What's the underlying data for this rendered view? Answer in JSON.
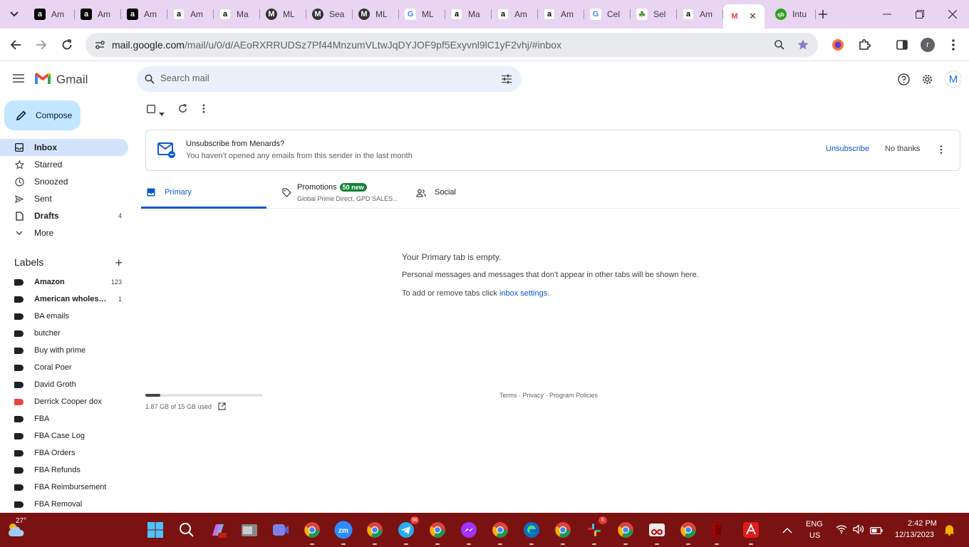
{
  "browser": {
    "tabs": [
      {
        "title": "Am",
        "favicon": "amazon-icon",
        "color": "#000000"
      },
      {
        "title": "Am",
        "favicon": "amazon-icon",
        "color": "#000000"
      },
      {
        "title": "Am",
        "favicon": "amazon-icon",
        "color": "#000000"
      },
      {
        "title": "Am",
        "favicon": "amazon-smile-icon",
        "color": "#ffffff"
      },
      {
        "title": "Ma",
        "favicon": "amazon-smile-icon",
        "color": "#ffffff"
      },
      {
        "title": "ML",
        "favicon": "mag-icon",
        "color": "#333333"
      },
      {
        "title": "Sea",
        "favicon": "mag-icon",
        "color": "#333333"
      },
      {
        "title": "ML",
        "favicon": "mag-icon",
        "color": "#333333"
      },
      {
        "title": "ML",
        "favicon": "google-icon",
        "color": "#ffffff"
      },
      {
        "title": "Ma",
        "favicon": "amazon-smile-icon",
        "color": "#ffffff"
      },
      {
        "title": "Am",
        "favicon": "amazon-smile-icon",
        "color": "#ffffff"
      },
      {
        "title": "Am",
        "favicon": "amazon-smile-icon",
        "color": "#ffffff"
      },
      {
        "title": "Cel",
        "favicon": "google-icon",
        "color": "#ffffff"
      },
      {
        "title": "Sel",
        "favicon": "plant-icon",
        "color": "#ffffff"
      },
      {
        "title": "Am",
        "favicon": "amazon-smile-icon",
        "color": "#ffffff"
      },
      {
        "title": "",
        "favicon": "gmail-icon",
        "color": "#ffffff",
        "active": true
      },
      {
        "title": "Intu",
        "favicon": "quickbooks-icon",
        "color": "#2ca01c"
      }
    ],
    "url_host": "mail.google.com",
    "url_path": "/mail/u/0/d/AEoRXRRUDSz7Pf44MnzumVLtwJqDYJOF9pf5Exyvnl9lC1yF2vhj/#inbox",
    "profile_initial": "r"
  },
  "gmail": {
    "logo_text": "Gmail",
    "search_placeholder": "Search mail",
    "avatar_initial": "M",
    "compose_label": "Compose",
    "nav": [
      {
        "label": "Inbox",
        "icon": "inbox-icon",
        "count": "",
        "active": true
      },
      {
        "label": "Starred",
        "icon": "star-icon",
        "count": ""
      },
      {
        "label": "Snoozed",
        "icon": "clock-icon",
        "count": ""
      },
      {
        "label": "Sent",
        "icon": "send-icon",
        "count": ""
      },
      {
        "label": "Drafts",
        "icon": "draft-icon",
        "count": "4",
        "bold": true
      },
      {
        "label": "More",
        "icon": "chevron-down-icon",
        "count": ""
      }
    ],
    "labels_title": "Labels",
    "labels": [
      {
        "name": "Amazon",
        "count": "123",
        "bold": true,
        "color": "#202124"
      },
      {
        "name": "American wholesal...",
        "count": "1",
        "bold": true,
        "color": "#202124"
      },
      {
        "name": "BA emails",
        "count": "",
        "color": "#202124"
      },
      {
        "name": "butcher",
        "count": "",
        "color": "#202124"
      },
      {
        "name": "Buy with prime",
        "count": "",
        "color": "#202124"
      },
      {
        "name": "Coral Poer",
        "count": "",
        "color": "#202124"
      },
      {
        "name": "David Groth",
        "count": "",
        "color": "#202124"
      },
      {
        "name": "Derrick Cooper dox",
        "count": "",
        "color": "#e8453c"
      },
      {
        "name": "FBA",
        "count": "",
        "color": "#202124"
      },
      {
        "name": "FBA Case Log",
        "count": "",
        "color": "#202124"
      },
      {
        "name": "FBA Orders",
        "count": "",
        "color": "#202124"
      },
      {
        "name": "FBA Refunds",
        "count": "",
        "color": "#202124"
      },
      {
        "name": "FBA Reimbursement",
        "count": "",
        "color": "#202124"
      },
      {
        "name": "FBA Removal",
        "count": "",
        "color": "#202124"
      }
    ],
    "banner": {
      "title": "Unsubscribe from Menards?",
      "subtitle": "You haven't opened any emails from this sender in the last month",
      "unsubscribe": "Unsubscribe",
      "no_thanks": "No thanks"
    },
    "tabs": {
      "primary": "Primary",
      "promotions": "Promotions",
      "promotions_badge": "50 new",
      "promotions_sub": "Global Prime Direct, GPD SALES...",
      "social": "Social"
    },
    "empty": {
      "heading": "Your Primary tab is empty.",
      "line1": "Personal messages and messages that don't appear in other tabs will be shown here.",
      "line2_prefix": "To add or remove tabs click ",
      "line2_link": "inbox settings",
      "line2_suffix": "."
    },
    "storage": {
      "text": "1.87 GB of 15 GB used",
      "fraction": 0.125
    },
    "footer": {
      "terms": "Terms",
      "privacy": "Privacy",
      "policies": "Program Policies",
      "sep": " · "
    }
  },
  "taskbar": {
    "weather_temp": "27°",
    "language": "ENG",
    "region": "US",
    "time": "2:42 PM",
    "date": "12/13/2023",
    "badges": {
      "telegram": "56",
      "slack": "5"
    },
    "icons": [
      "windows-start-icon",
      "search-icon",
      "copilot-icon",
      "file-explorer-icon",
      "teams-icon",
      "chrome-icon",
      "zoom-icon",
      "chrome-icon",
      "telegram-icon",
      "chrome-icon",
      "messenger-icon",
      "chrome-icon",
      "edge-icon",
      "chrome-icon",
      "slack-icon",
      "chrome-icon",
      "snipping-tool-icon",
      "chrome-icon",
      "app-icon",
      "acrobat-icon"
    ]
  }
}
